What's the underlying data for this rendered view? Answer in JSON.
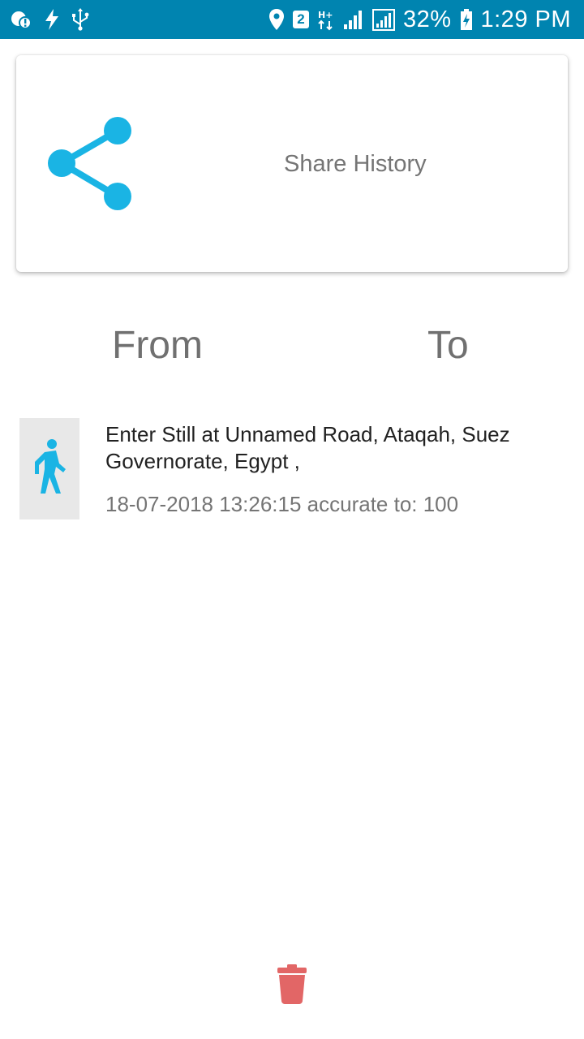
{
  "status_bar": {
    "left_icons": [
      "weather-alert-icon",
      "flash-icon",
      "usb-icon"
    ],
    "right_icons": [
      "location-pin-icon",
      "sim-2-icon",
      "hplus-network-icon",
      "signal-icon",
      "signal-boxed-icon",
      "battery-charging-icon"
    ],
    "sim_number": "2",
    "battery_percent": "32%",
    "time": "1:29 PM"
  },
  "share_card": {
    "icon": "share-icon",
    "label": "Share History"
  },
  "range": {
    "from_label": "From",
    "to_label": "To"
  },
  "entries": [
    {
      "icon": "walking-person-icon",
      "title": "Enter Still at Unnamed Road, Ataqah, Suez Governorate, Egypt ,",
      "meta": "18-07-2018 13:26:15 accurate to: 100"
    }
  ],
  "footer": {
    "delete_icon": "trash-icon"
  },
  "colors": {
    "status_bar": "#0084b0",
    "accent": "#1ab4e4",
    "delete": "#e26666",
    "entry_icon_bg": "#e8e8e8"
  }
}
